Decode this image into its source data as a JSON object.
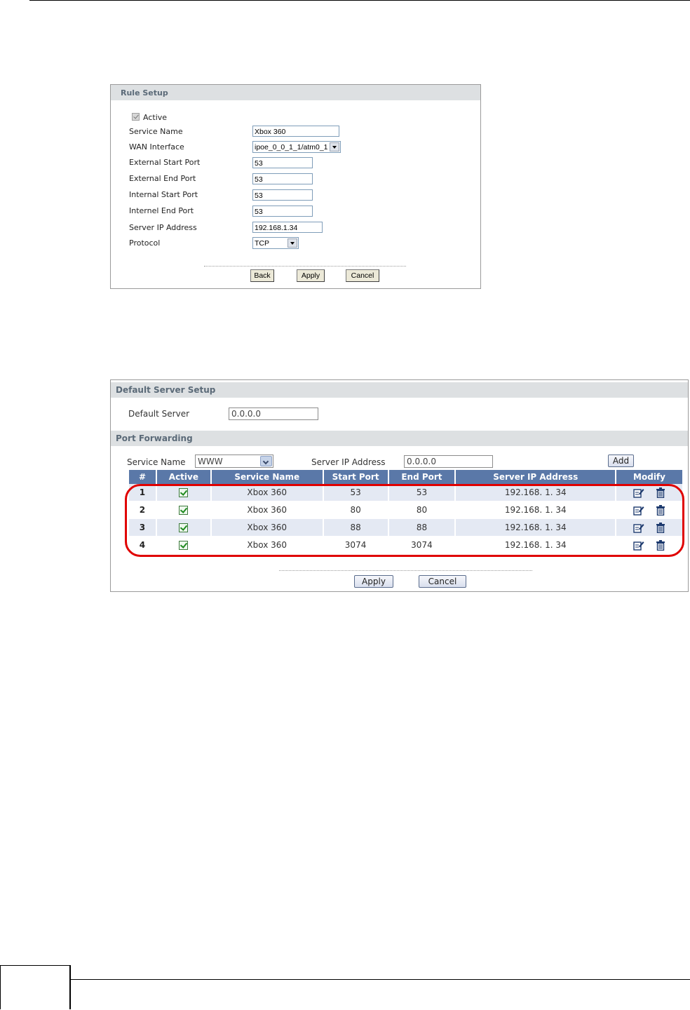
{
  "rule_setup": {
    "title": "Rule Setup",
    "active_label": "Active",
    "fields": [
      {
        "label": "Service Name",
        "value": "Xbox 360"
      },
      {
        "label": "WAN Interface",
        "value": "ipoe_0_0_1_1/atm0_1"
      },
      {
        "label": "External Start Port",
        "value": "53"
      },
      {
        "label": "External End Port",
        "value": "53"
      },
      {
        "label": "Internal Start Port",
        "value": "53"
      },
      {
        "label": "Internel End Port",
        "value": "53"
      },
      {
        "label": "Server IP Address",
        "value": "192.168.1.34"
      },
      {
        "label": "Protocol",
        "value": "TCP"
      }
    ],
    "buttons": {
      "back": "Back",
      "apply": "Apply",
      "cancel": "Cancel"
    }
  },
  "default_server_setup": {
    "title": "Default Server Setup",
    "label": "Default Server",
    "value": "0.0.0.0"
  },
  "port_forwarding": {
    "title": "Port Forwarding",
    "service_name_label": "Service Name",
    "service_name_value": "WWW",
    "server_ip_label": "Server IP Address",
    "server_ip_value": "0.0.0.0",
    "add_label": "Add",
    "columns": [
      "#",
      "Active",
      "Service Name",
      "Start Port",
      "End Port",
      "Server IP Address",
      "Modify"
    ],
    "rows": [
      {
        "num": "1",
        "active": true,
        "service": "Xbox 360",
        "start": "53",
        "end": "53",
        "ip": "192.168. 1. 34"
      },
      {
        "num": "2",
        "active": true,
        "service": "Xbox 360",
        "start": "80",
        "end": "80",
        "ip": "192.168. 1. 34"
      },
      {
        "num": "3",
        "active": true,
        "service": "Xbox 360",
        "start": "88",
        "end": "88",
        "ip": "192.168. 1. 34"
      },
      {
        "num": "4",
        "active": true,
        "service": "Xbox 360",
        "start": "3074",
        "end": "3074",
        "ip": "192.168. 1. 34"
      }
    ],
    "buttons": {
      "apply": "Apply",
      "cancel": "Cancel"
    }
  },
  "icons": [
    "checkbox-icon",
    "edit-icon",
    "trash-icon",
    "dropdown-arrow-icon"
  ],
  "colors": {
    "table_header": "#5a78a8",
    "highlight": "#e00000",
    "section_header": "#dde0e2"
  }
}
